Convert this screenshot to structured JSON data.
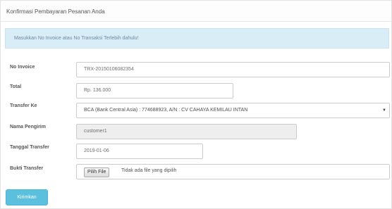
{
  "panel": {
    "title": "Konfirmasi Pembayaran Pesanan Anda"
  },
  "alert": {
    "message": "Masukkan No Invoice atau No Transaksi Terlebih dahulu!"
  },
  "form": {
    "invoice": {
      "label": "No Invoice",
      "value": "TRX-20150106082354"
    },
    "total": {
      "label": "Total",
      "value": "Rp. 136.000"
    },
    "transfer_to": {
      "label": "Transfer Ke",
      "selected": "BCA (Bank Central Asia) : 774688923, A/N : CV CAHAYA KEMILAU INTAN"
    },
    "sender_name": {
      "label": "Nama Pengirim",
      "value": "customer1"
    },
    "transfer_date": {
      "label": "Tanggal Transfer",
      "value": "2019-01-06"
    },
    "proof": {
      "label": "Bukti Transfer",
      "button_label": "Pilih File",
      "no_file_text": "Tidak ada file yang dipilih"
    },
    "submit_label": "Kirimkan"
  },
  "colors": {
    "alert_bg": "#d9edf7",
    "submit_bg": "#5bc0de"
  },
  "icons": {
    "select_caret": "chevron-down-icon"
  }
}
